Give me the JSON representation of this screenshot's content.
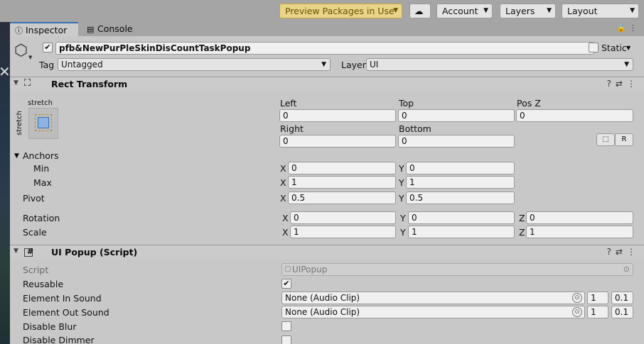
{
  "toolbar": {
    "preview_packages": "Preview Packages in Use",
    "account": "Account",
    "layers": "Layers",
    "layout": "Layout"
  },
  "tabs": {
    "inspector": "Inspector",
    "console": "Console"
  },
  "object": {
    "name": "pfb&NewPurPleSkinDisCountTaskPopup",
    "static_label": "Static",
    "tag_label": "Tag",
    "tag_value": "Untagged",
    "layer_label": "Layer",
    "layer_value": "UI"
  },
  "rect_transform": {
    "title": "Rect Transform",
    "anchor_preset_top": "stretch",
    "anchor_preset_side": "stretch",
    "left_label": "Left",
    "left_value": "0",
    "top_label": "Top",
    "top_value": "0",
    "posz_label": "Pos Z",
    "posz_value": "0",
    "right_label": "Right",
    "right_value": "0",
    "bottom_label": "Bottom",
    "bottom_value": "0",
    "r_button": "R",
    "anchors_label": "Anchors",
    "min_label": "Min",
    "min_x": "0",
    "min_y": "0",
    "max_label": "Max",
    "max_x": "1",
    "max_y": "1",
    "pivot_label": "Pivot",
    "pivot_x": "0.5",
    "pivot_y": "0.5",
    "rotation_label": "Rotation",
    "rot_x": "0",
    "rot_y": "0",
    "rot_z": "0",
    "scale_label": "Scale",
    "scale_x": "1",
    "scale_y": "1",
    "scale_z": "1",
    "x": "X",
    "y": "Y",
    "z": "Z"
  },
  "ui_popup": {
    "title": "UI Popup (Script)",
    "script_label": "Script",
    "script_value": "UIPopup",
    "reusable_label": "Reusable",
    "element_in_sound_label": "Element In Sound",
    "element_in_sound_value": "None (Audio Clip)",
    "in_volume": "1",
    "in_pitch": "0.1",
    "element_out_sound_label": "Element Out Sound",
    "element_out_sound_value": "None (Audio Clip)",
    "out_volume": "1",
    "out_pitch": "0.1",
    "disable_blur_label": "Disable Blur",
    "disable_dimmer_label": "Disable Dimmer"
  }
}
